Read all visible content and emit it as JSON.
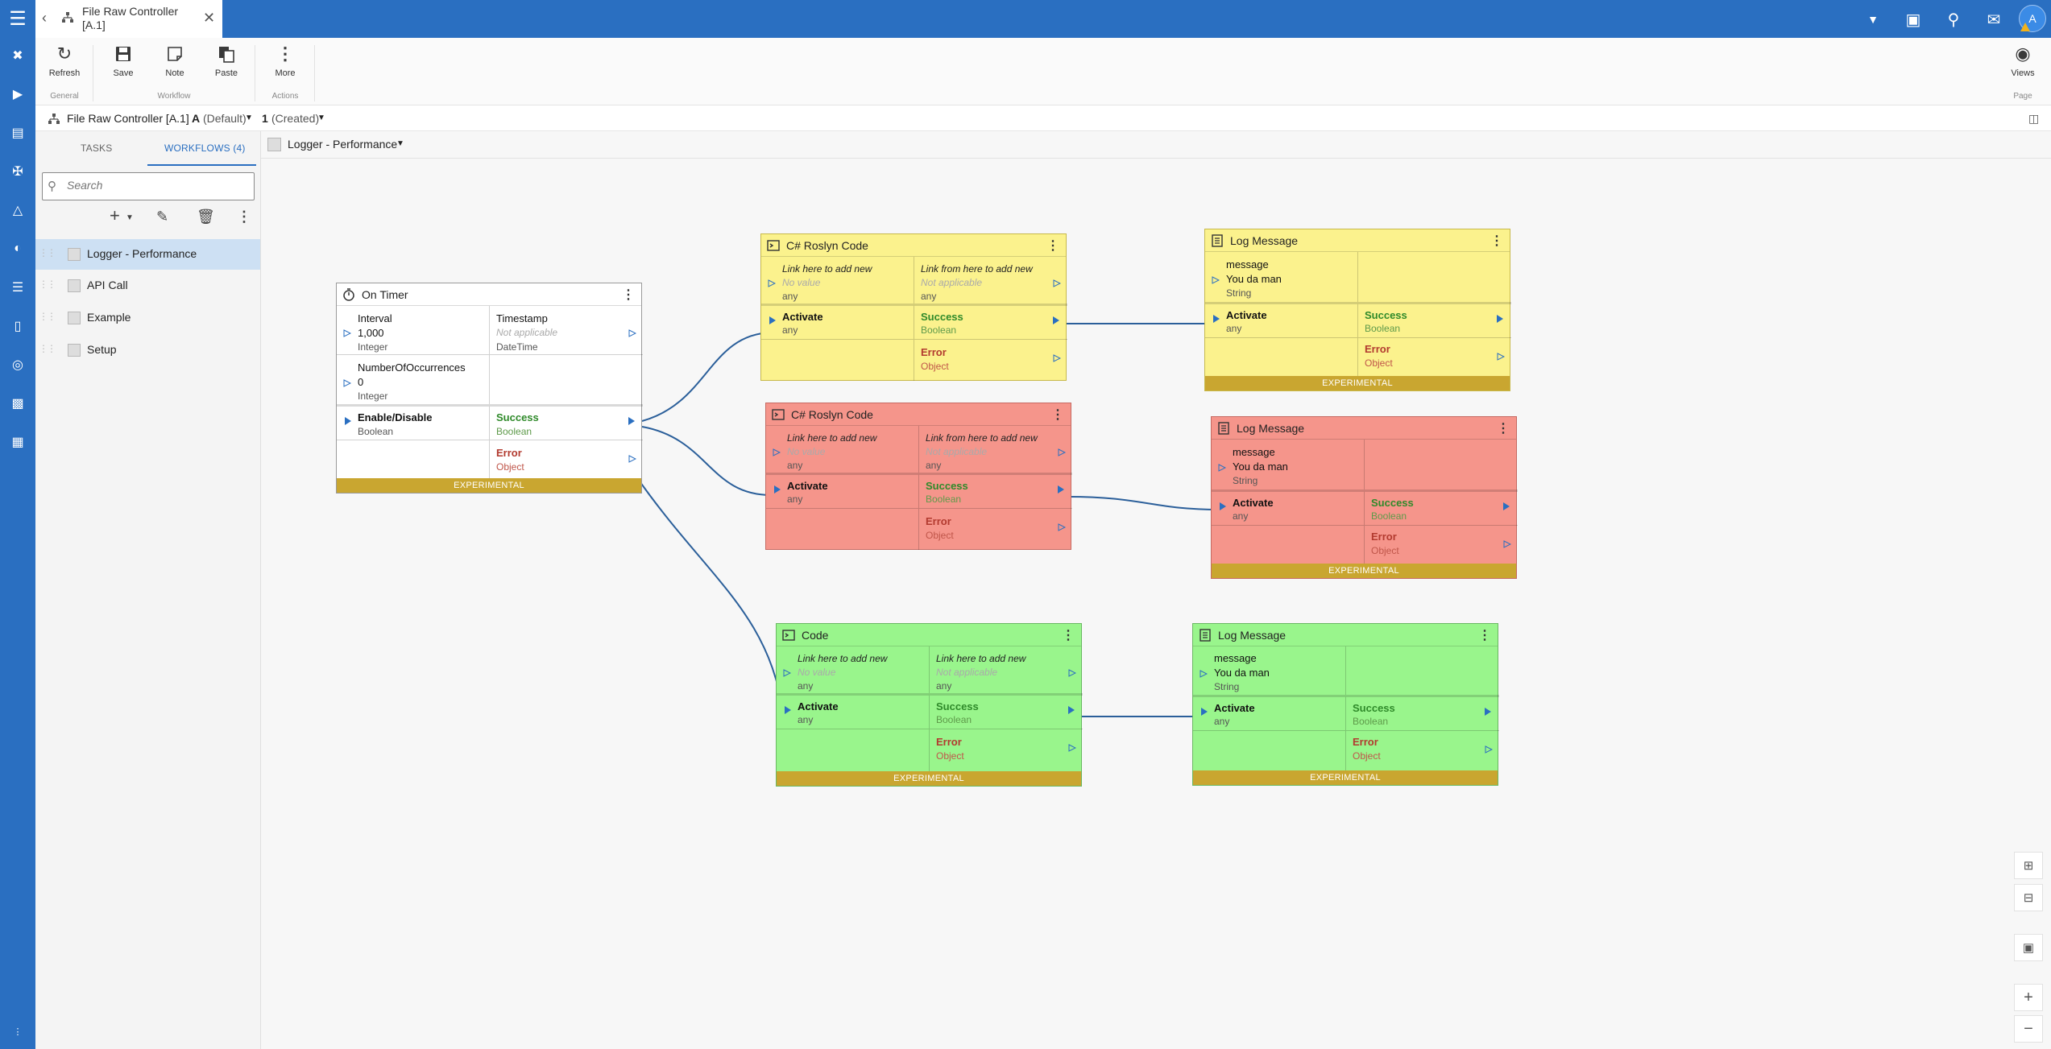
{
  "app": {
    "tab_title": "File Raw Controller [A.1]",
    "avatar_initial": "A"
  },
  "ribbon": {
    "refresh_label": "Refresh",
    "save_label": "Save",
    "note_label": "Note",
    "paste_label": "Paste",
    "more_label": "More",
    "views_label": "Views",
    "group_general": "General",
    "group_workflow": "Workflow",
    "group_actions": "Actions",
    "group_page": "Page"
  },
  "context": {
    "name": "File Raw Controller [A.1]",
    "variant_letter": "A",
    "variant_label": "(Default)",
    "revision_num": "1",
    "revision_label": "(Created)"
  },
  "sidepanel": {
    "tab_tasks": "TASKS",
    "tab_workflows": "WORKFLOWS (4)",
    "search_placeholder": "Search",
    "workflows": [
      "Logger - Performance",
      "API Call",
      "Example",
      "Setup"
    ]
  },
  "canvas": {
    "workflow_name": "Logger - Performance"
  },
  "nodes": {
    "timer": {
      "title": "On Timer",
      "interval_name": "Interval",
      "interval_value": "1,000",
      "interval_type": "Integer",
      "timestamp_name": "Timestamp",
      "timestamp_value": "Not applicable",
      "timestamp_type": "DateTime",
      "occ_name": "NumberOfOccurrences",
      "occ_value": "0",
      "occ_type": "Integer",
      "enable_name": "Enable/Disable",
      "enable_type": "Boolean",
      "success": "Success",
      "success_type": "Boolean",
      "error": "Error",
      "error_type": "Object",
      "footer": "EXPERIMENTAL"
    },
    "roslyn_y": {
      "title": "C# Roslyn Code",
      "in_hint": "Link here to add new",
      "in_value": "No value",
      "in_type": "any",
      "out_hint": "Link from here to add new",
      "out_value": "Not applicable",
      "out_type": "any",
      "activate": "Activate",
      "activate_type": "any",
      "success": "Success",
      "success_type": "Boolean",
      "error": "Error",
      "error_type": "Object"
    },
    "log_y": {
      "title": "Log Message",
      "msg_name": "message",
      "msg_value": "You da man",
      "msg_type": "String",
      "activate": "Activate",
      "activate_type": "any",
      "success": "Success",
      "success_type": "Boolean",
      "error": "Error",
      "error_type": "Object",
      "footer": "EXPERIMENTAL"
    },
    "roslyn_r": {
      "title": "C# Roslyn Code",
      "in_hint": "Link here to add new",
      "in_value": "No value",
      "in_type": "any",
      "out_hint": "Link from here to add new",
      "out_value": "Not applicable",
      "out_type": "any",
      "activate": "Activate",
      "activate_type": "any",
      "success": "Success",
      "success_type": "Boolean",
      "error": "Error",
      "error_type": "Object"
    },
    "log_r": {
      "title": "Log Message",
      "msg_name": "message",
      "msg_value": "You da man",
      "msg_type": "String",
      "activate": "Activate",
      "activate_type": "any",
      "success": "Success",
      "success_type": "Boolean",
      "error": "Error",
      "error_type": "Object",
      "footer": "EXPERIMENTAL"
    },
    "code_g": {
      "title": "Code",
      "in_hint": "Link here to add new",
      "in_value": "No value",
      "in_type": "any",
      "out_hint": "Link here to add new",
      "out_value": "Not applicable",
      "out_type": "any",
      "activate": "Activate",
      "activate_type": "any",
      "success": "Success",
      "success_type": "Boolean",
      "error": "Error",
      "error_type": "Object",
      "footer": "EXPERIMENTAL"
    },
    "log_g": {
      "title": "Log Message",
      "msg_name": "message",
      "msg_value": "You da man",
      "msg_type": "String",
      "activate": "Activate",
      "activate_type": "any",
      "success": "Success",
      "success_type": "Boolean",
      "error": "Error",
      "error_type": "Object",
      "footer": "EXPERIMENTAL"
    }
  },
  "colors": {
    "accent": "#2a6fc1",
    "node_yellow": "#fbf28d",
    "node_red": "#f5958b",
    "node_green": "#99f58c",
    "experimental_bar": "#c9a630"
  }
}
